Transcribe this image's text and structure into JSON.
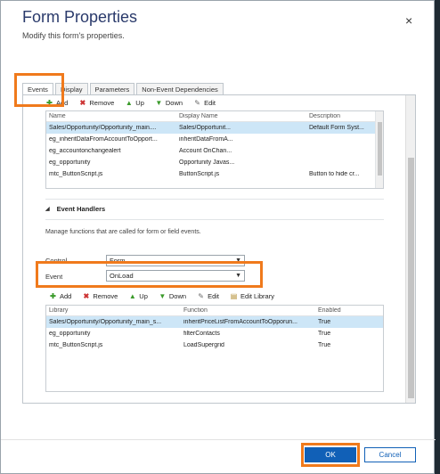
{
  "dialog": {
    "title": "Form Properties",
    "subtitle": "Modify this form's properties.",
    "close_glyph": "×"
  },
  "tabs": [
    {
      "label": "Events",
      "active": true
    },
    {
      "label": "Display",
      "active": false
    },
    {
      "label": "Parameters",
      "active": false
    },
    {
      "label": "Non-Event Dependencies",
      "active": false
    }
  ],
  "libraries_toolbar": {
    "add": "Add",
    "remove": "Remove",
    "up": "Up",
    "down": "Down",
    "edit": "Edit"
  },
  "libraries_grid": {
    "columns": [
      "Name",
      "Display Name",
      "Description"
    ],
    "rows": [
      {
        "name": "Sales/Opportunity/Opportunity_main....",
        "display": "Sales/Opportunit...",
        "description": "Default Form Syst...",
        "selected": true
      },
      {
        "name": "eg_inheritDataFromAccountToOpport...",
        "display": "inheritDataFromA...",
        "description": "",
        "selected": false
      },
      {
        "name": "eg_accountonchangealert",
        "display": "Account OnChan...",
        "description": "",
        "selected": false
      },
      {
        "name": "eg_opportunity",
        "display": "Opportunity Javas...",
        "description": "",
        "selected": false
      },
      {
        "name": "mtc_ButtonScript.js",
        "display": "ButtonScript.js",
        "description": "Button to hide cr...",
        "selected": false
      }
    ]
  },
  "event_handlers": {
    "section_title": "Event Handlers",
    "help_text": "Manage functions that are called for form or field events.",
    "control_label": "Control",
    "control_value": "Form",
    "event_label": "Event",
    "event_value": "OnLoad"
  },
  "handlers_toolbar": {
    "add": "Add",
    "remove": "Remove",
    "up": "Up",
    "down": "Down",
    "edit": "Edit",
    "edit_library": "Edit Library"
  },
  "handlers_grid": {
    "columns": [
      "Library",
      "Function",
      "Enabled"
    ],
    "rows": [
      {
        "library": "Sales/Opportunity/Opportunity_main_s...",
        "function": "inheritPriceListFromAccountToOpporun...",
        "enabled": "True",
        "selected": true
      },
      {
        "library": "eg_opportunity",
        "function": "filterContacts",
        "enabled": "True",
        "selected": false
      },
      {
        "library": "mtc_ButtonScript.js",
        "function": "LoadSupergrid",
        "enabled": "True",
        "selected": false
      }
    ]
  },
  "footer": {
    "ok_label": "OK",
    "cancel_label": "Cancel"
  },
  "colors": {
    "title": "#2a3a6b",
    "highlight": "#f07a1c",
    "primary_button": "#1160b7",
    "selected_row": "#cde6f7"
  }
}
